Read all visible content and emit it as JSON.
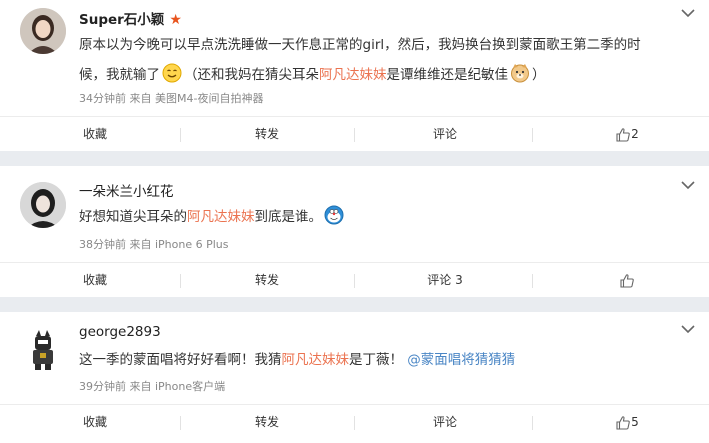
{
  "posts": [
    {
      "username": "Super石小颖",
      "has_star": true,
      "content_line1": "原本以为今晚可以早点洗洗睡做一天作息正常的girl，然后，我妈换台换到蒙面歌王第二季的时",
      "content_line2_a": "候，我就输了",
      "content_line2_b": "（还和我妈在猜尖耳朵",
      "content_line2_hl": "阿凡达妹妹",
      "content_line2_c": "是谭维维还是纪敏佳",
      "content_line2_d": "）",
      "emoji_1": "smile-emoji",
      "emoji_2": "doge-emoji",
      "meta": "34分钟前 来自 美图M4-夜间自拍神器",
      "actions": {
        "collect": "收藏",
        "repost": "转发",
        "comment": "评论",
        "like_count": "2"
      }
    },
    {
      "username": "一朵米兰小红花",
      "content_a": "好想知道尖耳朵的",
      "content_hl": "阿凡达妹妹",
      "content_b": "到底是谁。",
      "emoji": "doraemon-emoji",
      "meta": "38分钟前 来自 iPhone 6 Plus",
      "actions": {
        "collect": "收藏",
        "repost": "转发",
        "comment": "评论 3",
        "like_count": ""
      }
    },
    {
      "username": "george2893",
      "content_a": "这一季的蒙面唱将好好看啊！我猜",
      "content_hl": "阿凡达妹妹",
      "content_b": "是丁薇！",
      "content_link": "@蒙面唱将猜猜猜",
      "meta": "39分钟前 来自 iPhone客户端",
      "actions": {
        "collect": "收藏",
        "repost": "转发",
        "comment": "评论",
        "like_count": "5"
      }
    }
  ],
  "colors": {
    "highlight": "#eb7350",
    "link": "#4a86c5",
    "star": "#e8541e",
    "separator": "#e9ecf0"
  }
}
